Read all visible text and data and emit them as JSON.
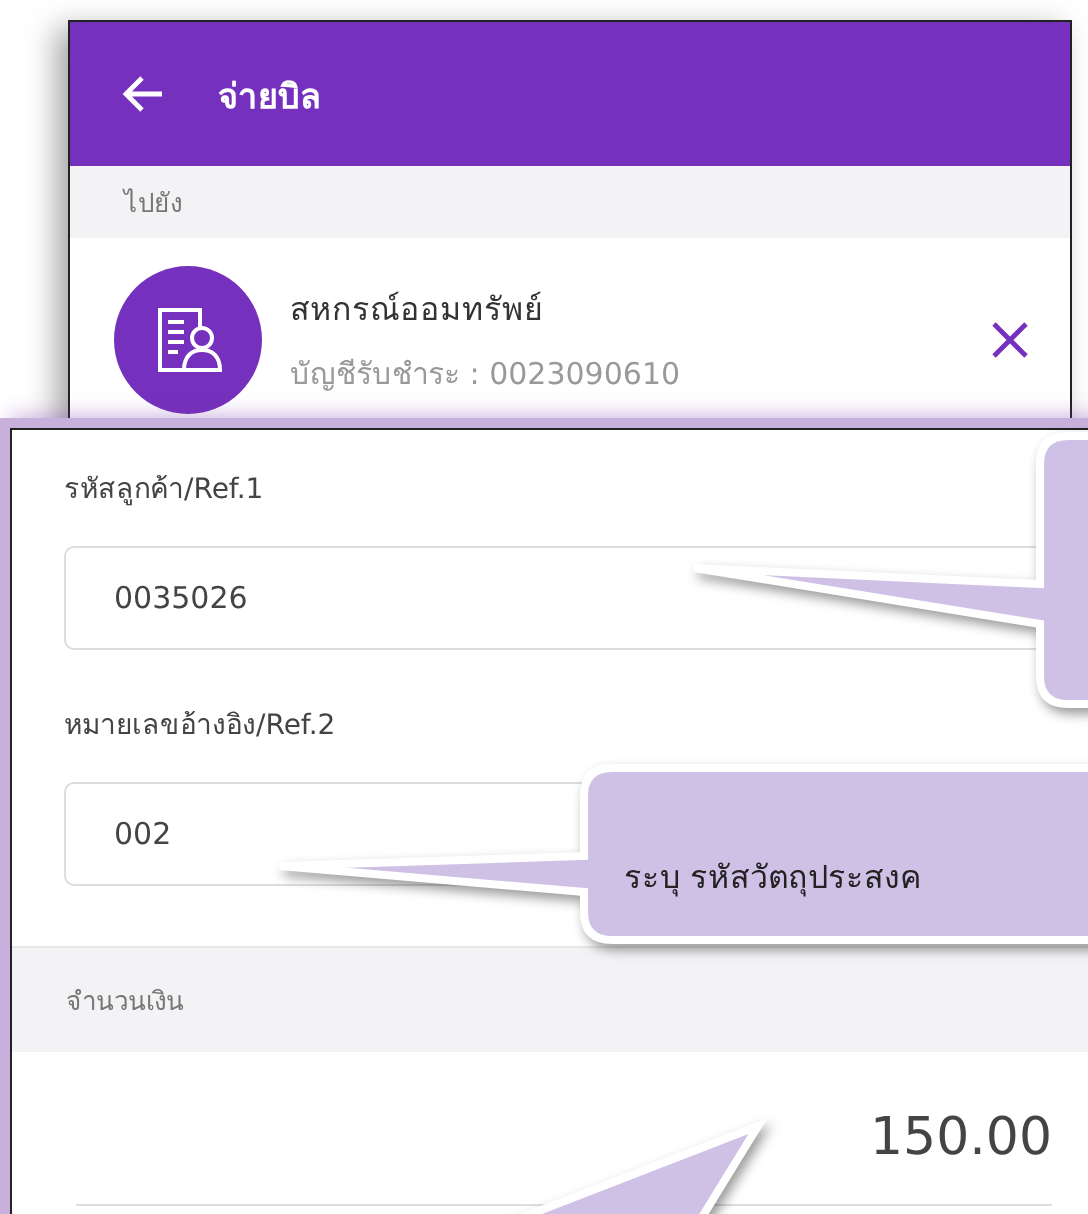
{
  "top_screen": {
    "title": "จ่ายบิล",
    "section_label": "ไปยัง",
    "payee": {
      "name": "สหกรณ์ออมทรัพย์",
      "account": "บัญชีรับชำระ : 0023090610"
    }
  },
  "form": {
    "fields": [
      {
        "label": "รหัสลูกค้า/Ref.1",
        "value": "0035026"
      },
      {
        "label": "หมายเลขอ้างอิง/Ref.2",
        "value": "002"
      }
    ],
    "amount_label": "จำนวนเงิน",
    "amount": "150.00"
  },
  "callout": {
    "text": "ระบุ รหัสวัตถุประสงค"
  }
}
